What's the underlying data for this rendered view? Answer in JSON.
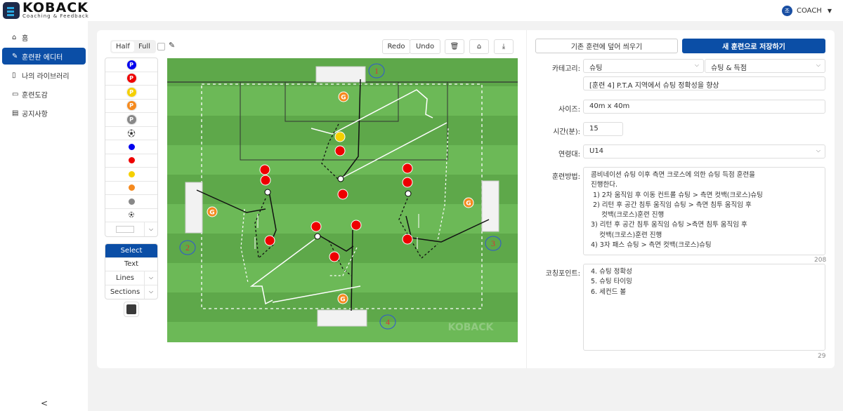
{
  "app": {
    "logo": "KOBACK",
    "logo_sub": "Coaching & Feedback",
    "user_initial": "조",
    "user_name": "COACH"
  },
  "sidebar": {
    "items": [
      {
        "label": "홈",
        "icon": "home-icon"
      },
      {
        "label": "훈련판 에디터",
        "icon": "pencil-icon",
        "active": true
      },
      {
        "label": "나의 라이브러리",
        "icon": "book-icon"
      },
      {
        "label": "훈련도감",
        "icon": "open-book-icon"
      },
      {
        "label": "공지사항",
        "icon": "notice-icon"
      }
    ],
    "collapse": "<"
  },
  "editor": {
    "half": "Half",
    "full": "Full",
    "redo": "Redo",
    "undo": "Undo",
    "palette": [
      {
        "type": "player",
        "color": "#0000ee",
        "label": "P"
      },
      {
        "type": "player",
        "color": "#ee0000",
        "label": "P"
      },
      {
        "type": "player",
        "color": "#f5d000",
        "label": "P"
      },
      {
        "type": "player",
        "color": "#f58a1f",
        "label": "P"
      },
      {
        "type": "player",
        "color": "#888888",
        "label": "P"
      },
      {
        "type": "ball"
      },
      {
        "type": "dot",
        "color": "#0000ee"
      },
      {
        "type": "dot",
        "color": "#ee0000"
      },
      {
        "type": "dot",
        "color": "#f5d000"
      },
      {
        "type": "dot",
        "color": "#f58a1f"
      },
      {
        "type": "dot",
        "color": "#888888"
      },
      {
        "type": "ball-small"
      }
    ],
    "tools": {
      "select": "Select",
      "text": "Text",
      "lines": "Lines",
      "sections": "Sections"
    },
    "pen_color": "#3a3a3a",
    "pitch": {
      "watermark": "KOBACK",
      "markers": [
        "1",
        "2",
        "3",
        "4"
      ],
      "goalkeeper_label": "G"
    }
  },
  "form": {
    "overwrite": "기존 훈련에 덮어 씌우기",
    "save_new": "새 훈련으로 저장하기",
    "category_label": "카테고리:",
    "category1": "슈팅",
    "category2": "슈팅 & 득점",
    "title": "[훈련 4] P.T.A 지역에서 슈팅 정확성을 향상",
    "size_label": "사이즈:",
    "size": "40m x 40m",
    "time_label": "시간(분):",
    "time": "15",
    "age_label": "연령대:",
    "age": "U14",
    "method_label": "훈련방법:",
    "method": "콤비네이션 슈팅 이후 측면 크로스에 의한 슈팅 득점 훈련을\n진행한다.\n 1) 2차 움직임 후 이동 컨트롤 슈팅 > 측면 컷백(크로스)슈팅\n 2) 리턴 후 공간 침투 움직임 슈팅 > 측면 침투 움직임 후\n     컷백(크로스)훈련 진행\n3) 리턴 후 공간 침투 움직임 슈팅 >측면 침투 움직임 후\n    컷백(크로스)훈련 진행\n4) 3자 패스 슈팅 > 측면 컷백(크로스)슈팅",
    "method_count": "208",
    "coaching_label": "코칭포인트:",
    "coaching": "4. 슈팅 정확성\n5. 슈팅 타이밍\n6. 세컨드 볼",
    "coaching_count": "29"
  }
}
